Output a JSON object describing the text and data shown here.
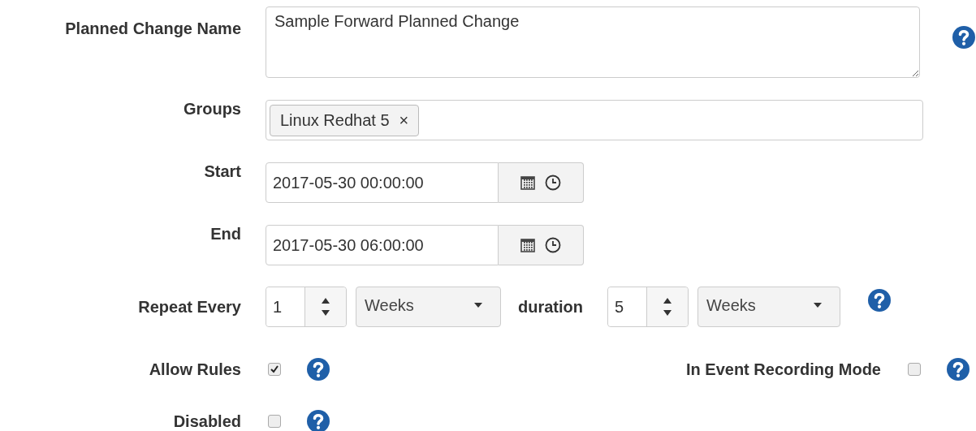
{
  "form": [
    {
      "kind": "textarea",
      "label": "Planned Change Name",
      "value": "Sample Forward Planned Change",
      "help": true
    },
    {
      "kind": "tags",
      "label": "Groups",
      "tags": [
        {
          "text": "Linux Redhat 5",
          "remove": "×"
        }
      ],
      "help": false
    },
    {
      "kind": "datetime",
      "label": "Start",
      "value": "2017-05-30 00:00:00",
      "help": false
    },
    {
      "kind": "datetime",
      "label": "End",
      "value": "2017-05-30 06:00:00",
      "help": false
    },
    {
      "kind": "repeat",
      "label": "Repeat Every",
      "count": "1",
      "unit": "Weeks",
      "duration_label": "duration",
      "duration_count": "5",
      "duration_unit": "Weeks",
      "help": true
    },
    {
      "kind": "checkbox",
      "label": "Allow Rules",
      "checked": true,
      "help": true,
      "extra": {
        "label": "In Event Recording Mode",
        "checked": false,
        "help": true
      }
    },
    {
      "kind": "checkbox",
      "label": "Disabled",
      "checked": false,
      "help": true
    }
  ]
}
